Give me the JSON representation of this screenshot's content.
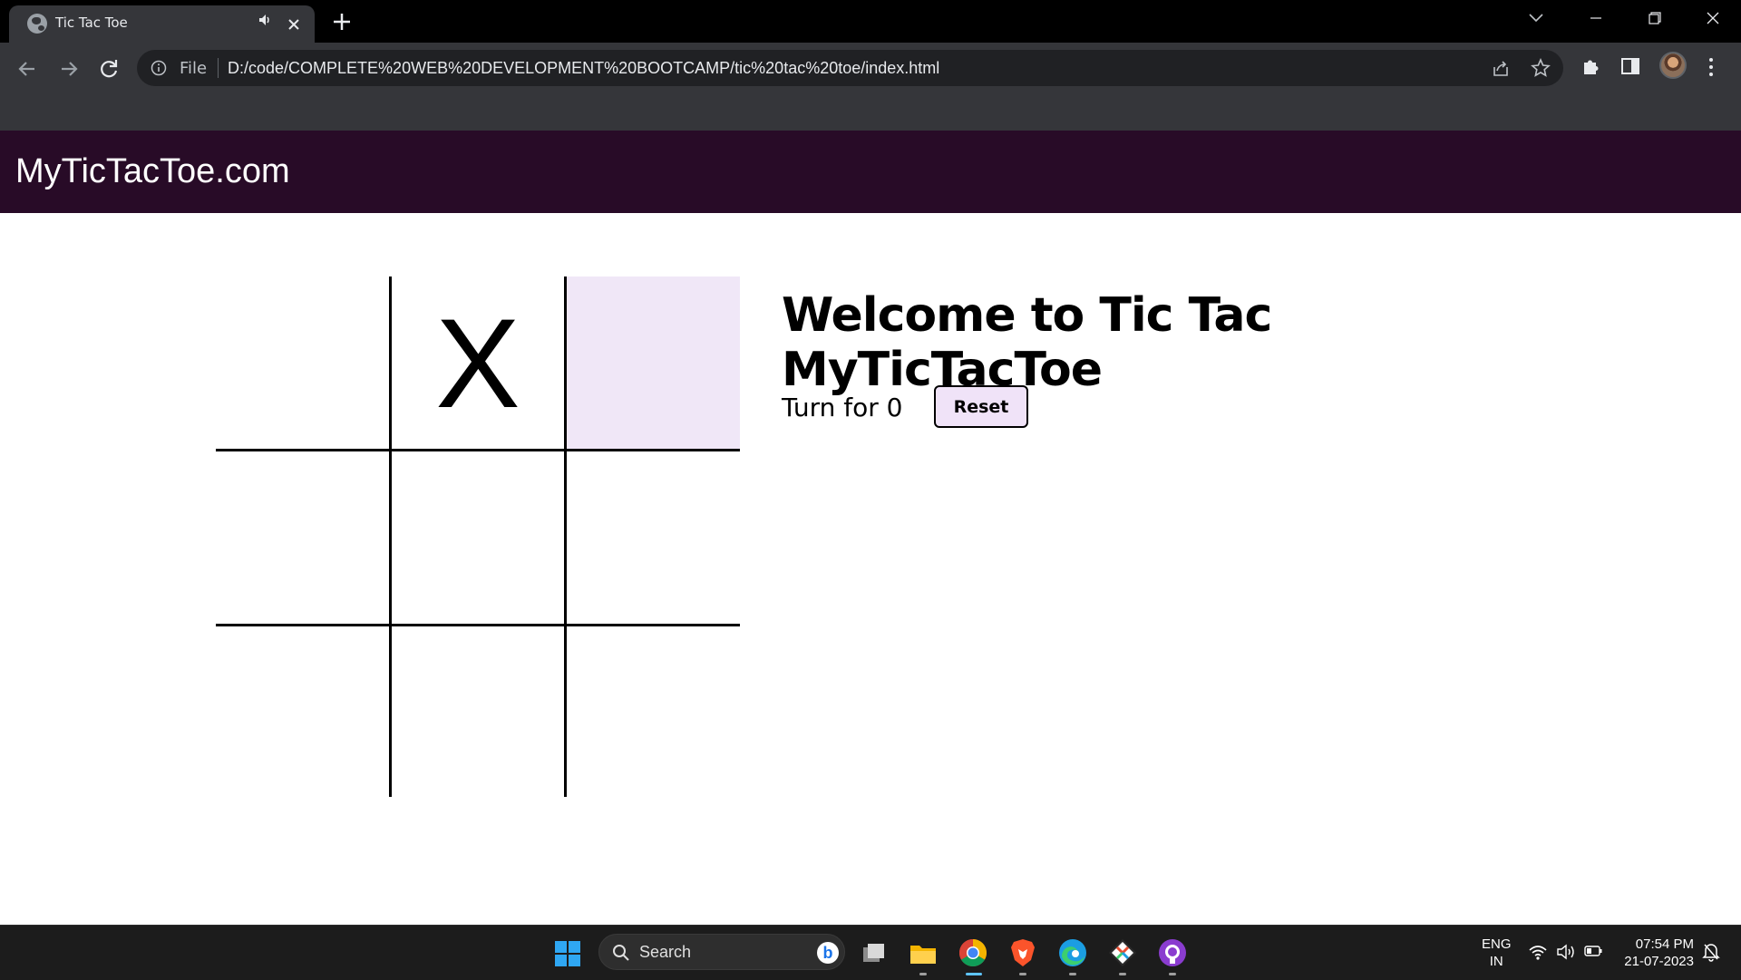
{
  "browser": {
    "tab_title": "Tic Tac Toe",
    "scheme_label": "File",
    "url": "D:/code/COMPLETE%20WEB%20DEVELOPMENT%20BOOTCAMP/tic%20tac%20toe/index.html",
    "icons": [
      "globe-icon",
      "audio-icon",
      "close-icon",
      "plus-icon",
      "chevron-down-icon",
      "minimize-icon",
      "restore-icon",
      "close-icon",
      "back-arrow-icon",
      "forward-arrow-icon",
      "reload-icon",
      "info-icon",
      "share-icon",
      "star-icon",
      "puzzle-icon",
      "side-panel-icon",
      "avatar",
      "kebab-menu-icon"
    ]
  },
  "site": {
    "name": "MyTicTacToe.com",
    "header_color": "#280b27"
  },
  "game": {
    "board": [
      "",
      "X",
      "",
      "",
      "",
      "",
      "",
      "",
      ""
    ],
    "hovered_cell": 2,
    "hover_color": "#f0e7f7",
    "heading": "Welcome to Tic Tac MyTicTacToe",
    "turn_text": "Turn for 0",
    "reset_label": "Reset"
  },
  "taskbar": {
    "search_label": "Search",
    "apps": [
      "task-view-icon",
      "file-explorer-icon",
      "chrome-icon",
      "brave-icon",
      "edge-icon",
      "git-icon",
      "github-desktop-icon"
    ],
    "lang_line1": "ENG",
    "lang_line2": "IN",
    "time": "07:54 PM",
    "date": "21-07-2023"
  }
}
